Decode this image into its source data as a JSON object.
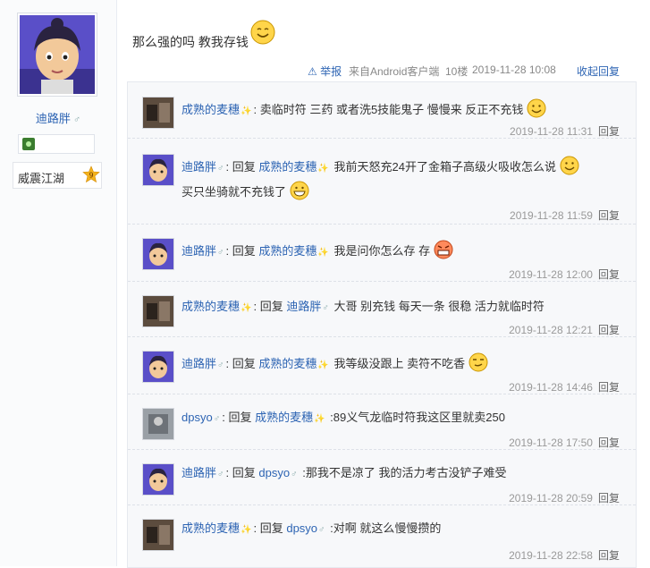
{
  "user": {
    "name": "迪路胖",
    "rank_title": "威震江湖",
    "rank_level": "9"
  },
  "post": {
    "text": "那么强的吗 教我存钱",
    "report": "举报",
    "source": "来自Android客户端",
    "floor": "10楼",
    "time": "2019-11-28 10:08",
    "collapse": "收起回复"
  },
  "replies": [
    {
      "user": "成熟的麦穗",
      "target": "",
      "text": "卖临时符 三药 或者洗5技能鬼子 慢慢来 反正不充钱",
      "time": "2019-11-28 11:31",
      "reply": "回复"
    },
    {
      "user": "迪路胖",
      "prefix": "回复",
      "target": "成熟的麦穗",
      "text": "我前天怒充24开了金箱子高级火吸收怎么说",
      "text2": "买只坐骑就不充钱了",
      "time": "2019-11-28 11:59",
      "reply": "回复"
    },
    {
      "user": "迪路胖",
      "prefix": "回复",
      "target": "成熟的麦穗",
      "text": "我是问你怎么存 存",
      "time": "2019-11-28 12:00",
      "reply": "回复"
    },
    {
      "user": "成熟的麦穗",
      "prefix": "回复",
      "target": "迪路胖",
      "text": "大哥 别充钱 每天一条 很稳 活力就临时符",
      "time": "2019-11-28 12:21",
      "reply": "回复"
    },
    {
      "user": "迪路胖",
      "prefix": "回复",
      "target": "成熟的麦穗",
      "text": "我等级没跟上 卖符不吃香",
      "time": "2019-11-28 14:46",
      "reply": "回复"
    },
    {
      "user": "dpsyo",
      "prefix": "回复",
      "target": "成熟的麦穗",
      "text": ":89义气龙临时符我这区里就卖250",
      "time": "2019-11-28 17:50",
      "reply": "回复"
    },
    {
      "user": "迪路胖",
      "prefix": "回复",
      "target": "dpsyo",
      "text": ":那我不是凉了 我的活力考古没铲子难受",
      "time": "2019-11-28 20:59",
      "reply": "回复"
    },
    {
      "user": "成熟的麦穗",
      "prefix": "回复",
      "target": "dpsyo",
      "text": ":对啊 就这么慢慢攒的",
      "time": "2019-11-28 22:58",
      "reply": "回复"
    }
  ],
  "colors": {
    "link": "#2d64b3",
    "meta": "#999999",
    "accent": "#e6a000"
  }
}
